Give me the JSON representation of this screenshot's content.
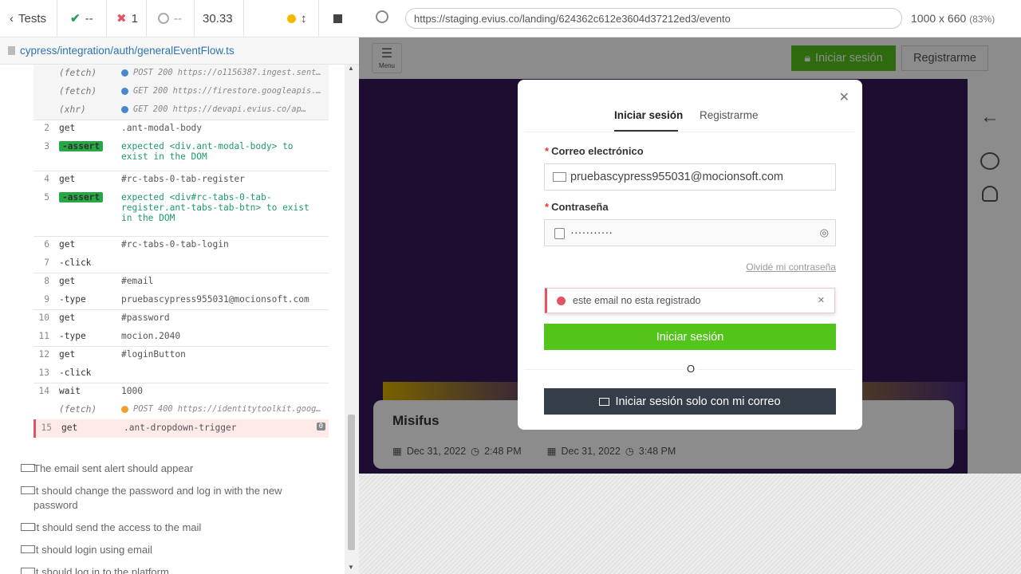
{
  "reporter": {
    "tests_label": "Tests",
    "passed": "--",
    "failed": "1",
    "pending": "--",
    "duration": "30.33",
    "spec_path": "cypress/integration/auth/generalEventFlow.ts"
  },
  "commands": [
    {
      "num": "",
      "name": "(fetch)",
      "msg": "POST 200 https://o1156387.ingest.sentry.i…",
      "xhr": true,
      "dot": "#4a86c8"
    },
    {
      "num": "",
      "name": "(fetch)",
      "msg": "GET 200 https://firestore.googleapis.com/…",
      "xhr": true,
      "dot": "#4a86c8"
    },
    {
      "num": "",
      "name": "(xhr)",
      "msg": "GET 200 https://devapi.evius.co/ap…",
      "xhr": true,
      "dot": "#4a86c8"
    },
    {
      "num": "2",
      "name": "get",
      "msg": ".ant-modal-body"
    },
    {
      "num": "3",
      "name": "-assert",
      "msg": "expected <div.ant-modal-body> to exist in the DOM",
      "assert": true
    },
    {
      "num": "4",
      "name": "get",
      "msg": "#rc-tabs-0-tab-register"
    },
    {
      "num": "5",
      "name": "-assert",
      "msg": "expected <div#rc-tabs-0-tab-register.ant-tabs-tab-btn> to exist in the DOM",
      "assert": true
    },
    {
      "num": "6",
      "name": "get",
      "msg": "#rc-tabs-0-tab-login"
    },
    {
      "num": "7",
      "name": "-click",
      "msg": ""
    },
    {
      "num": "8",
      "name": "get",
      "msg": "#email"
    },
    {
      "num": "9",
      "name": "-type",
      "msg": "pruebascypress955031@mocionsoft.com"
    },
    {
      "num": "10",
      "name": "get",
      "msg": "#password"
    },
    {
      "num": "11",
      "name": "-type",
      "msg": "mocion.2040"
    },
    {
      "num": "12",
      "name": "get",
      "msg": "#loginButton"
    },
    {
      "num": "13",
      "name": "-click",
      "msg": ""
    },
    {
      "num": "14",
      "name": "wait",
      "msg": "1000"
    },
    {
      "num": "",
      "name": "(fetch)",
      "msg": "POST 400 https://identitytoolkit.googleap…",
      "xhr": true,
      "dot": "#f0a030"
    },
    {
      "num": "15",
      "name": "get",
      "msg": ".ant-dropdown-trigger",
      "error": true,
      "count": "0"
    }
  ],
  "tests": [
    "The email sent alert should appear",
    "it should change the password and log in with the new password",
    "It should send the access to the mail",
    "it should login using email",
    "it should log in to the platform"
  ],
  "browser": {
    "url": "https://staging.evius.co/landing/624362c612e3604d37212ed3/evento",
    "size": "1000 x 660",
    "zoom": "(83%)"
  },
  "app": {
    "menu_label": "Menu",
    "login_button": "Iniciar sesión",
    "register_button": "Registrarme",
    "event_name": "Misifus",
    "start_date": "Dec 31, 2022",
    "start_time": "2:48 PM",
    "end_date": "Dec 31, 2022",
    "end_time": "3:48 PM"
  },
  "modal": {
    "tab_login": "Iniciar sesión",
    "tab_register": "Registrarme",
    "email_label": "Correo electrónico",
    "email_value": "pruebascypress955031@mocionsoft.com",
    "password_label": "Contraseña",
    "password_value": "···········",
    "forgot": "Olvidé mi contraseña",
    "alert": "este email no esta registrado",
    "submit": "Iniciar sesión",
    "divider": "O",
    "email_only": "Iniciar sesión solo con mi correo"
  },
  "colors": {
    "green": "#52c41a",
    "dark": "#353e48",
    "error": "#e05561"
  }
}
